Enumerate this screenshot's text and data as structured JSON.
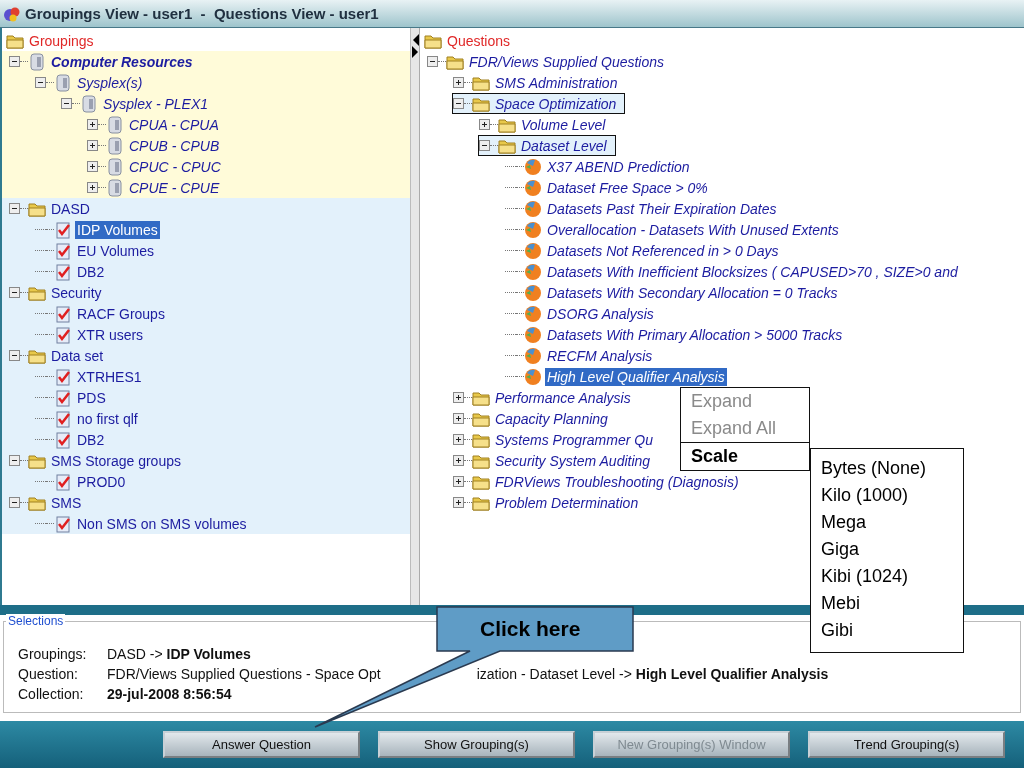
{
  "window": {
    "title": "Groupings View - user1  -  Questions View - user1"
  },
  "groupings": {
    "root": {
      "label": "Groupings",
      "kind": "folder",
      "selected": false,
      "children": [
        {
          "label": "Computer Resources",
          "kind": "server",
          "bold": true,
          "color": "#fffbd9",
          "expanded": true,
          "selected": false,
          "children": [
            {
              "label": "Sysplex(s)",
              "kind": "server",
              "expanded": true,
              "selected": false,
              "children": [
                {
                  "label": "Sysplex - PLEX1",
                  "kind": "server",
                  "expanded": true,
                  "selected": false,
                  "children": [
                    {
                      "label": "CPUA - CPUA",
                      "kind": "server",
                      "expanded": false,
                      "selected": false
                    },
                    {
                      "label": "CPUB - CPUB",
                      "kind": "server",
                      "expanded": false,
                      "selected": false
                    },
                    {
                      "label": "CPUC - CPUC",
                      "kind": "server",
                      "expanded": false,
                      "selected": false
                    },
                    {
                      "label": "CPUE - CPUE",
                      "kind": "server",
                      "expanded": false,
                      "selected": false
                    }
                  ]
                }
              ]
            }
          ]
        },
        {
          "label": "DASD",
          "kind": "folder",
          "color": "#e3f1fb",
          "expanded": true,
          "selected": false,
          "children": [
            {
              "label": "IDP Volumes",
              "kind": "check",
              "selected": true
            },
            {
              "label": "EU Volumes",
              "kind": "check",
              "selected": false
            },
            {
              "label": "DB2",
              "kind": "check",
              "selected": false
            }
          ]
        },
        {
          "label": "Security",
          "kind": "folder",
          "color": "#e3f1fb",
          "expanded": true,
          "selected": false,
          "children": [
            {
              "label": "RACF Groups",
              "kind": "check",
              "selected": false
            },
            {
              "label": "XTR users",
              "kind": "check",
              "selected": false
            }
          ]
        },
        {
          "label": "Data set",
          "kind": "folder",
          "color": "#e3f1fb",
          "expanded": true,
          "selected": false,
          "children": [
            {
              "label": "XTRHES1",
              "kind": "check",
              "selected": false
            },
            {
              "label": "PDS",
              "kind": "check",
              "selected": false
            },
            {
              "label": "no first qlf",
              "kind": "check",
              "selected": false
            },
            {
              "label": "DB2",
              "kind": "check",
              "selected": false
            }
          ]
        },
        {
          "label": "SMS Storage groups",
          "kind": "folder",
          "color": "#e3f1fb",
          "expanded": true,
          "selected": false,
          "children": [
            {
              "label": "PROD0",
              "kind": "check",
              "selected": false
            }
          ]
        },
        {
          "label": "SMS",
          "kind": "folder",
          "color": "#e3f1fb",
          "expanded": true,
          "selected": false,
          "children": [
            {
              "label": "Non SMS on SMS volumes",
              "kind": "check",
              "selected": false
            }
          ]
        }
      ]
    }
  },
  "questions": {
    "root": {
      "label": "Questions",
      "kind": "folder",
      "selected": false,
      "children": [
        {
          "label": "FDR/Views Supplied Questions",
          "kind": "folder",
          "expanded": true,
          "selected": false,
          "children": [
            {
              "label": "SMS Administration",
              "kind": "folder",
              "expanded": false,
              "selected": false
            },
            {
              "label": "Space Optimization",
              "kind": "folder",
              "expanded": true,
              "highlighted": true,
              "selected": false,
              "children": [
                {
                  "label": "Volume Level",
                  "kind": "folder",
                  "expanded": false,
                  "selected": false
                },
                {
                  "label": "Dataset Level",
                  "kind": "folder",
                  "expanded": true,
                  "highlighted": true,
                  "selected": false,
                  "children": [
                    {
                      "label": "X37 ABEND Prediction",
                      "kind": "question",
                      "selected": false
                    },
                    {
                      "label": "Dataset Free Space > 0%",
                      "kind": "question",
                      "selected": false
                    },
                    {
                      "label": "Datasets Past Their Expiration Dates",
                      "kind": "question",
                      "selected": false
                    },
                    {
                      "label": "Overallocation - Datasets With Unused Extents",
                      "kind": "question",
                      "selected": false
                    },
                    {
                      "label": "Datasets Not Referenced in > 0 Days",
                      "kind": "question",
                      "selected": false
                    },
                    {
                      "label": "Datasets With Inefficient Blocksizes ( CAPUSED>70 , SIZE>0 and",
                      "kind": "question",
                      "selected": false
                    },
                    {
                      "label": "Datasets With Secondary Allocation = 0 Tracks",
                      "kind": "question",
                      "selected": false
                    },
                    {
                      "label": "DSORG Analysis",
                      "kind": "question",
                      "selected": false
                    },
                    {
                      "label": "Datasets With Primary Allocation > 5000 Tracks",
                      "kind": "question",
                      "selected": false
                    },
                    {
                      "label": "RECFM Analysis",
                      "kind": "question",
                      "selected": false
                    },
                    {
                      "label": "High Level Qualifier Analysis",
                      "kind": "question",
                      "selected": true
                    }
                  ]
                }
              ]
            },
            {
              "label": "Performance Analysis",
              "kind": "folder",
              "expanded": false,
              "selected": false
            },
            {
              "label": "Capacity Planning",
              "kind": "folder",
              "expanded": false,
              "selected": false
            },
            {
              "label": "Systems Programmer Qu",
              "kind": "folder",
              "expanded": false,
              "selected": false
            },
            {
              "label": "Security System Auditing",
              "kind": "folder",
              "expanded": false,
              "selected": false
            },
            {
              "label": "FDRViews Troubleshooting (Diagnosis)",
              "kind": "folder",
              "expanded": false,
              "selected": false
            },
            {
              "label": "Problem Determination",
              "kind": "folder",
              "expanded": false,
              "selected": false
            }
          ]
        }
      ]
    }
  },
  "context_menu": {
    "items": [
      {
        "label": "Expand",
        "disabled": true,
        "open": false
      },
      {
        "label": "Expand All",
        "disabled": true,
        "open": false
      },
      {
        "label": "Scale",
        "disabled": false,
        "open": true
      }
    ],
    "submenu": [
      "Bytes (None)",
      "Kilo (1000)",
      "Mega",
      "Giga",
      "Kibi (1024)",
      "Mebi",
      "Gibi"
    ]
  },
  "selections": {
    "legend": "Selections",
    "rows": [
      {
        "label": "Groupings:",
        "values": [
          "DASD -> **IDP Volumes**"
        ],
        "bold": false
      },
      {
        "label": "Question:",
        "values": [
          "FDR/Views Supplied Questions - Space Opt",
          "ization - Dataset Level -> **High Level Qualifier Analysis**"
        ],
        "bold": false
      },
      {
        "label": "Collection:",
        "values": [
          "29-jul-2008 8:56:54"
        ],
        "bold": true
      }
    ]
  },
  "buttons": [
    {
      "label": "Answer Question",
      "disabled": false
    },
    {
      "label": "Show Grouping(s)",
      "disabled": false
    },
    {
      "label": "New Grouping(s) Window",
      "disabled": true
    },
    {
      "label": "Trend Grouping(s)",
      "disabled": false
    }
  ],
  "callout": {
    "text": "Click here"
  }
}
